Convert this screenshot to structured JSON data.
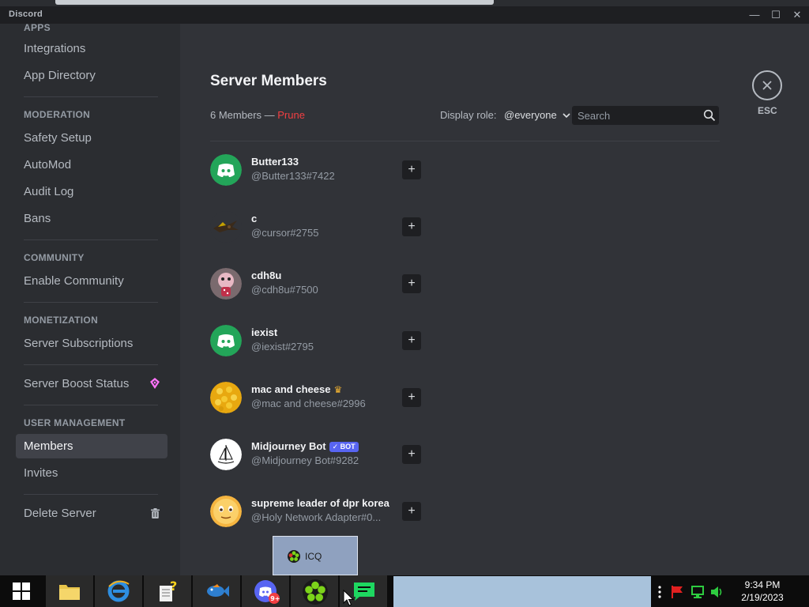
{
  "window": {
    "app_name": "Discord",
    "minimize": "—",
    "maximize": "☐",
    "close": "✕"
  },
  "sidebar": {
    "sections": [
      {
        "header": "APPS",
        "items": [
          "Integrations",
          "App Directory"
        ]
      },
      {
        "header": "MODERATION",
        "items": [
          "Safety Setup",
          "AutoMod",
          "Audit Log",
          "Bans"
        ]
      },
      {
        "header": "COMMUNITY",
        "items": [
          "Enable Community"
        ]
      },
      {
        "header": "MONETIZATION",
        "items": [
          "Server Subscriptions"
        ]
      },
      {
        "header": "",
        "items": [
          "Server Boost Status"
        ]
      },
      {
        "header": "USER MANAGEMENT",
        "items": [
          "Members",
          "Invites"
        ]
      },
      {
        "header": "",
        "items": [
          "Delete Server"
        ]
      }
    ],
    "active_item": "Members"
  },
  "main": {
    "title": "Server Members",
    "member_count": "6 Members —",
    "prune_label": "Prune",
    "display_role_label": "Display role:",
    "display_role_value": "@everyone",
    "search_placeholder": "Search",
    "esc_label": "ESC",
    "add_role_symbol": "+",
    "members": [
      {
        "name": "Butter133",
        "tag": "@Butter133#7422",
        "avatar": "discord-default-green"
      },
      {
        "name": "c",
        "tag": "@cursor#2755",
        "avatar": "cursor-bird"
      },
      {
        "name": "cdh8u",
        "tag": "@cdh8u#7500",
        "avatar": "pink-character"
      },
      {
        "name": "iexist",
        "tag": "@iexist#2795",
        "avatar": "discord-default-green"
      },
      {
        "name": "mac and cheese",
        "tag": "@mac and cheese#2996",
        "avatar": "mac-and-cheese",
        "owner": true
      },
      {
        "name": "Midjourney Bot",
        "tag": "@Midjourney Bot#9282",
        "avatar": "midjourney-boat",
        "bot_badge": "✓ BOT"
      },
      {
        "name": "supreme leader of dpr korea",
        "tag": "@Holy Network Adapter#0...",
        "avatar": "yellow-emoji-face"
      }
    ]
  },
  "tooltip": {
    "label": "ICQ"
  },
  "taskbar": {
    "apps": [
      "start-button",
      "file-explorer",
      "internet-explorer",
      "help-notepad",
      "paint-fish",
      "discord",
      "icq",
      "notes-app"
    ],
    "discord_badge": "9+",
    "clock_time": "9:34 PM",
    "clock_date": "2/19/2023"
  },
  "colors": {
    "sidebar_bg": "#2b2d31",
    "main_bg": "#313338",
    "prune": "#f23f42",
    "bot_badge": "#5865f2",
    "discord_green": "#23a559"
  }
}
